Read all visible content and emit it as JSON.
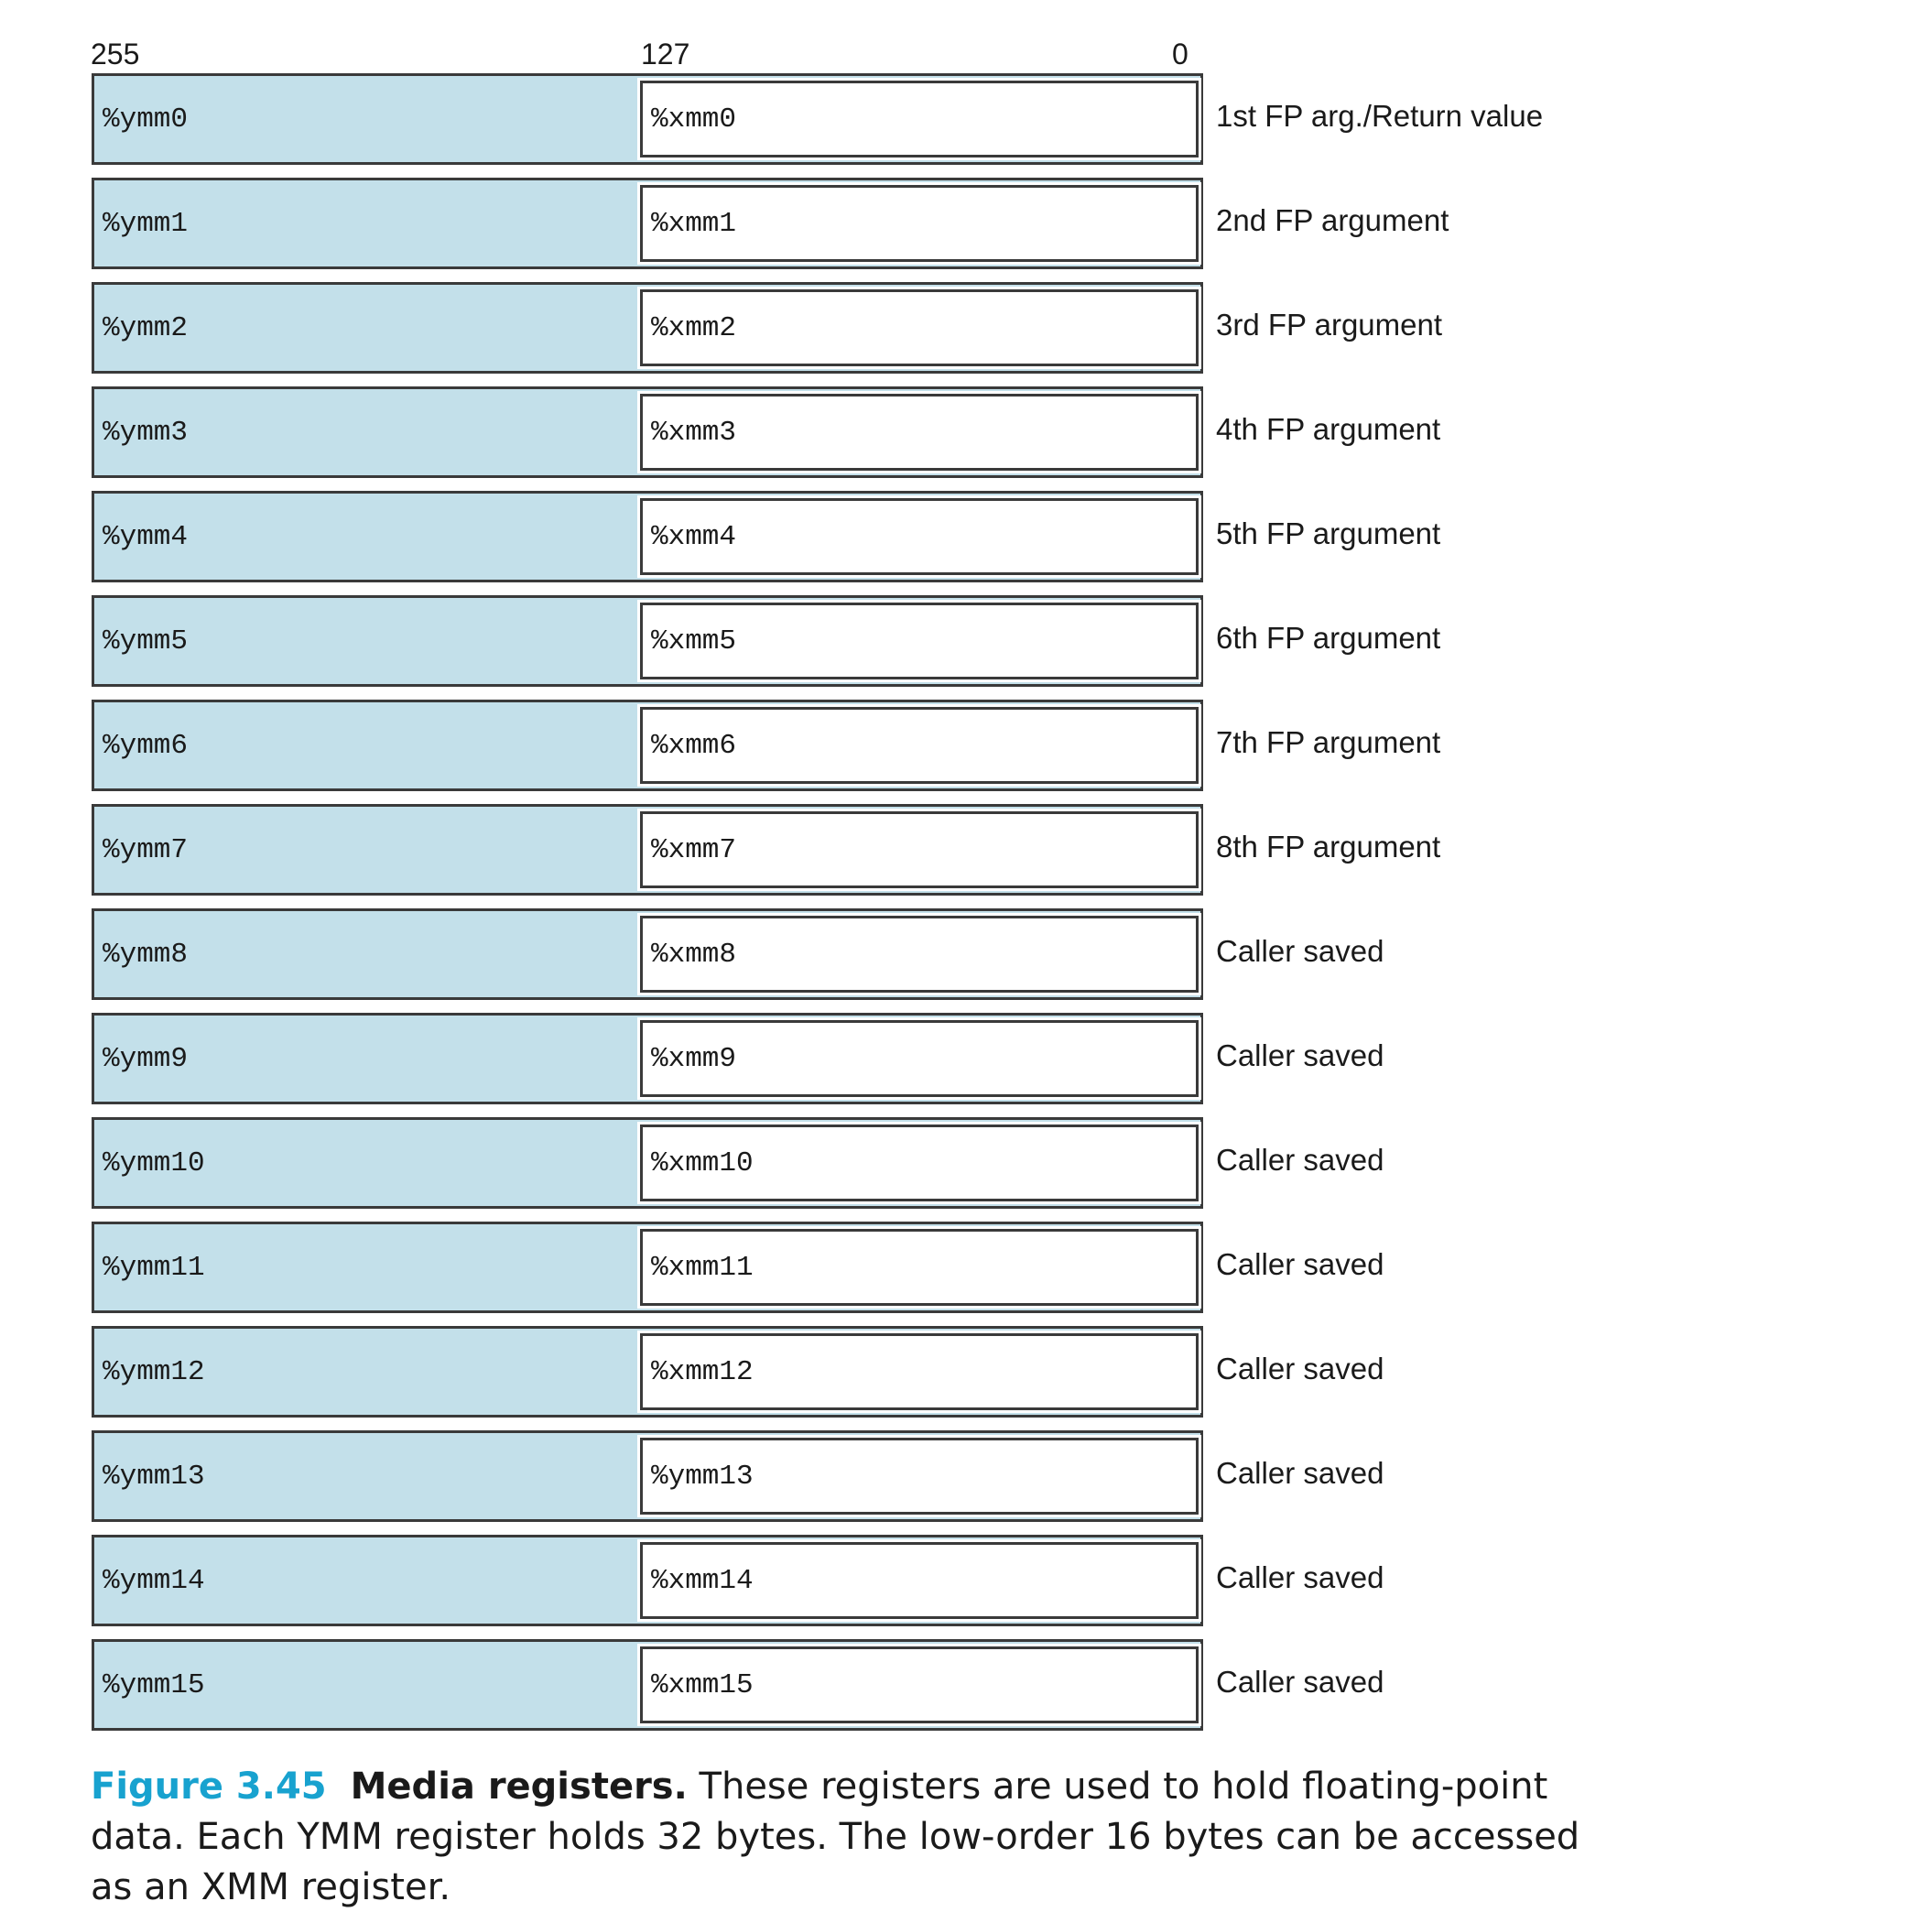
{
  "bit_labels": {
    "high": "255",
    "mid": "127",
    "low": "0"
  },
  "registers": [
    {
      "ymm": "%ymm0",
      "xmm": "%xmm0",
      "use": "1st FP arg./Return value"
    },
    {
      "ymm": "%ymm1",
      "xmm": "%xmm1",
      "use": "2nd FP argument"
    },
    {
      "ymm": "%ymm2",
      "xmm": "%xmm2",
      "use": "3rd FP argument"
    },
    {
      "ymm": "%ymm3",
      "xmm": "%xmm3",
      "use": "4th FP argument"
    },
    {
      "ymm": "%ymm4",
      "xmm": "%xmm4",
      "use": "5th FP argument"
    },
    {
      "ymm": "%ymm5",
      "xmm": "%xmm5",
      "use": "6th FP argument"
    },
    {
      "ymm": "%ymm6",
      "xmm": "%xmm6",
      "use": "7th FP argument"
    },
    {
      "ymm": "%ymm7",
      "xmm": "%xmm7",
      "use": "8th FP argument"
    },
    {
      "ymm": "%ymm8",
      "xmm": "%xmm8",
      "use": "Caller saved"
    },
    {
      "ymm": "%ymm9",
      "xmm": "%xmm9",
      "use": "Caller saved"
    },
    {
      "ymm": "%ymm10",
      "xmm": "%xmm10",
      "use": "Caller saved"
    },
    {
      "ymm": "%ymm11",
      "xmm": "%xmm11",
      "use": "Caller saved"
    },
    {
      "ymm": "%ymm12",
      "xmm": "%xmm12",
      "use": "Caller saved"
    },
    {
      "ymm": "%ymm13",
      "xmm": "%ymm13",
      "use": "Caller saved"
    },
    {
      "ymm": "%ymm14",
      "xmm": "%xmm14",
      "use": "Caller saved"
    },
    {
      "ymm": "%ymm15",
      "xmm": "%xmm15",
      "use": "Caller saved"
    }
  ],
  "caption": {
    "figure_number": "Figure 3.45",
    "title": "Media registers.",
    "text": "These registers are used to hold floating-point data. Each YMM register holds 32 bytes. The low-order 16 bytes can be accessed as an XMM register."
  },
  "colors": {
    "ymm_fill": "#c3e0ea",
    "xmm_fill": "#ffffff",
    "border": "#3a3a3a",
    "figure_accent": "#18a2cf"
  }
}
